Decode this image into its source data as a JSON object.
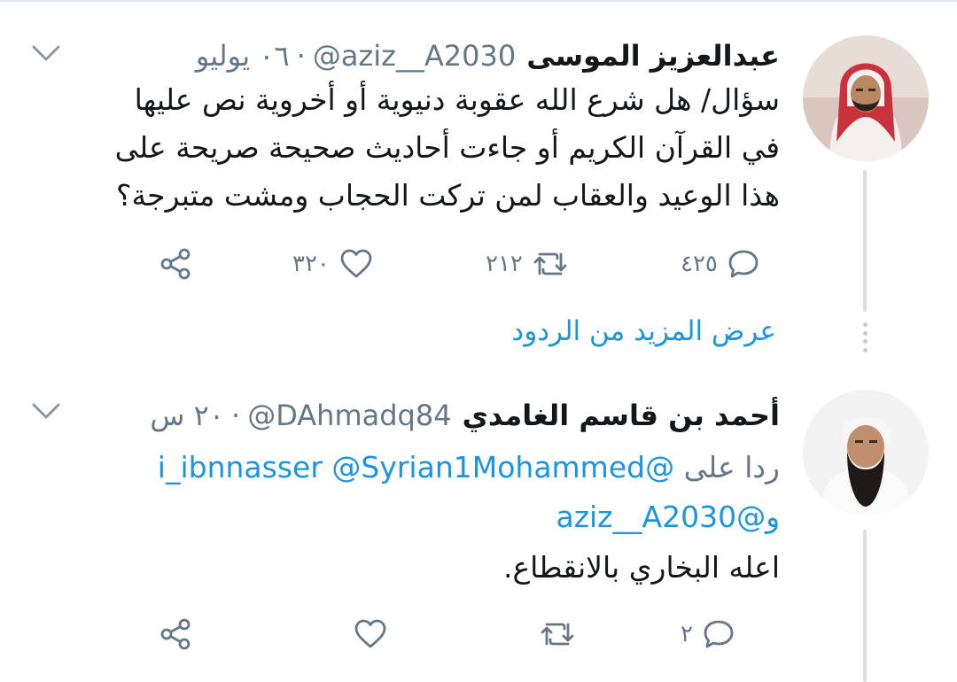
{
  "colors": {
    "accent": "#1b95e0",
    "muted": "#657786",
    "text": "#14171a",
    "thread_line": "#d9dee2"
  },
  "tweets": [
    {
      "display_name": "عبدالعزيز الموسى",
      "handle": "@aziz__A2030",
      "separator": "·",
      "time": "٠٦ يوليو",
      "text_lines": [
        "سؤال/ هل شرع الله عقوبة دنيوية أو أخروية نص عليها",
        "في القرآن الكريم أو جاءت أحاديث صحيحة صريحة على",
        "هذا الوعيد والعقاب لمن تركت الحجاب ومشت متبرجة؟"
      ],
      "reply_count": "٤٢٥",
      "retweet_count": "٢١٢",
      "like_count": "٣٢٠"
    },
    {
      "display_name": "أحمد بن قاسم الغامدي",
      "handle": "@DAhmadq84",
      "separator": "·",
      "time": "٢٠ س",
      "reply_label": "ردا على",
      "reply_mentions": [
        "@i_ibnnasser",
        "@Syrian1Mohammed"
      ],
      "reply_conjunction": "و",
      "reply_last_mention": "@aziz__A2030",
      "text": "اعله البخاري بالانقطاع.",
      "reply_count": "٢",
      "retweet_count": "",
      "like_count": ""
    }
  ],
  "show_more_replies": "عرض المزيد من الردود",
  "icons": [
    "chevron-down-icon",
    "reply-icon",
    "retweet-icon",
    "like-icon",
    "share-icon"
  ]
}
